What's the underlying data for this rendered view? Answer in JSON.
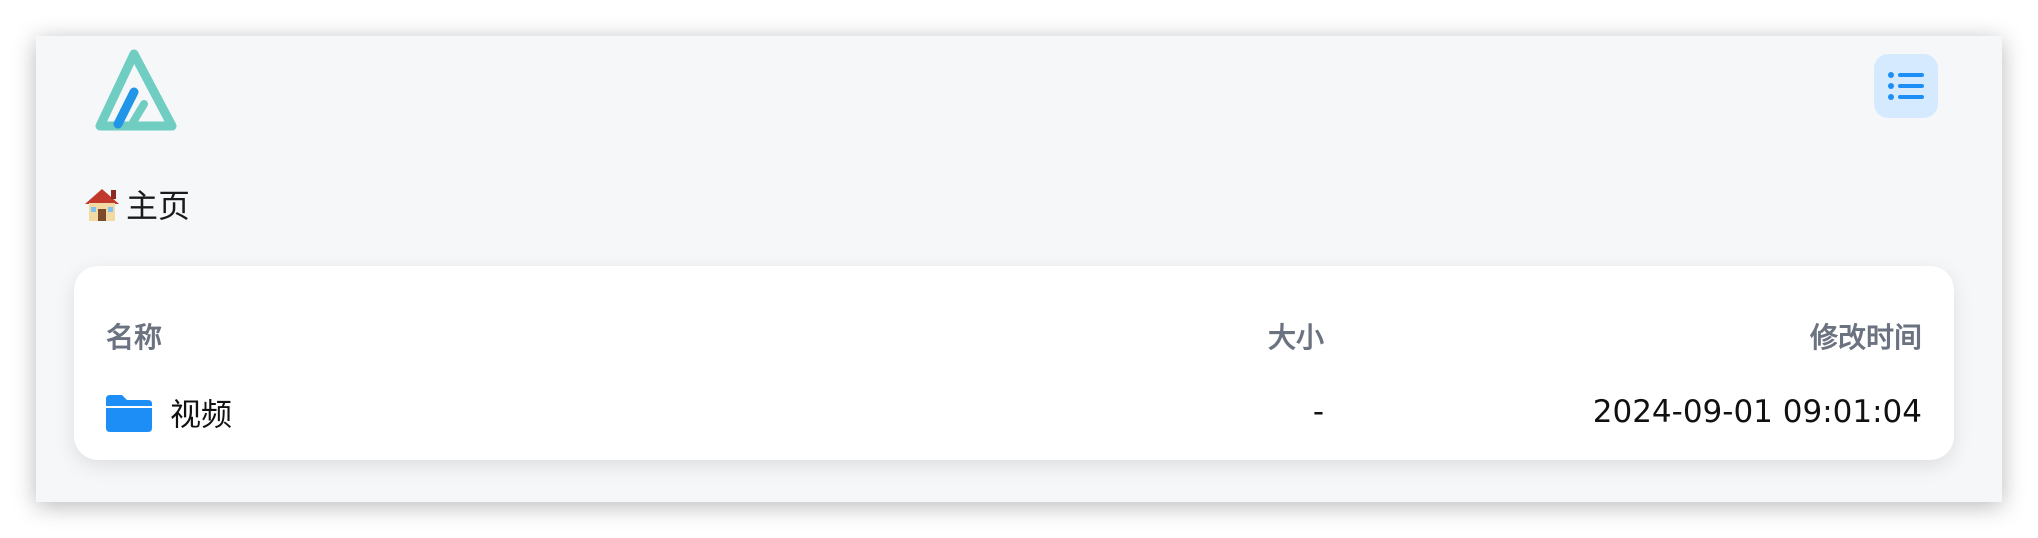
{
  "header": {
    "logo_icon": "alist-logo-icon",
    "list_toggle_icon": "list-icon"
  },
  "breadcrumb": {
    "icon": "house-icon",
    "label": "主页"
  },
  "table": {
    "columns": {
      "name": "名称",
      "size": "大小",
      "modified": "修改时间"
    },
    "rows": [
      {
        "icon": "folder-icon",
        "name": "视频",
        "size": "-",
        "modified": "2024-09-01 09:01:04"
      }
    ]
  },
  "colors": {
    "accent": "#1e8ef7",
    "logo_teal": "#6fcdc2",
    "logo_blue": "#2196e8",
    "toggle_bg": "#d6eaff",
    "page_bg": "#f6f7f9"
  }
}
